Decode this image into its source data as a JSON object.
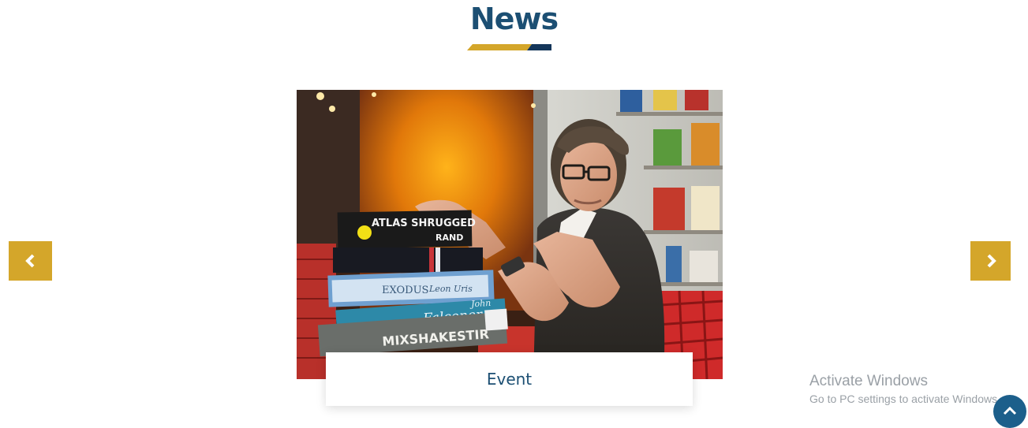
{
  "section": {
    "title": "News"
  },
  "carousel": {
    "prev_icon": "chevron-left-icon",
    "next_icon": "chevron-right-icon",
    "slide": {
      "caption": "Event",
      "image_alt": "Man with a stack of books"
    }
  },
  "books": {
    "book1_title": "ATLAS SHRUGGED",
    "book1_author": "RAND",
    "book3_title": "EXODUS",
    "book3_author": "Leon Uris",
    "book4_title": "Falconer",
    "book4_author": "John",
    "book5_title": "MIXSHAKESTIR"
  },
  "watermark": {
    "title": "Activate Windows",
    "subtitle": "Go to PC settings to activate Windows."
  },
  "scroll_top": {
    "icon": "chevron-up-icon"
  },
  "colors": {
    "title_blue": "#1c4f73",
    "accent_gold": "#d4a62a",
    "navy": "#14365a",
    "scroll_button": "#1c5f8b"
  }
}
